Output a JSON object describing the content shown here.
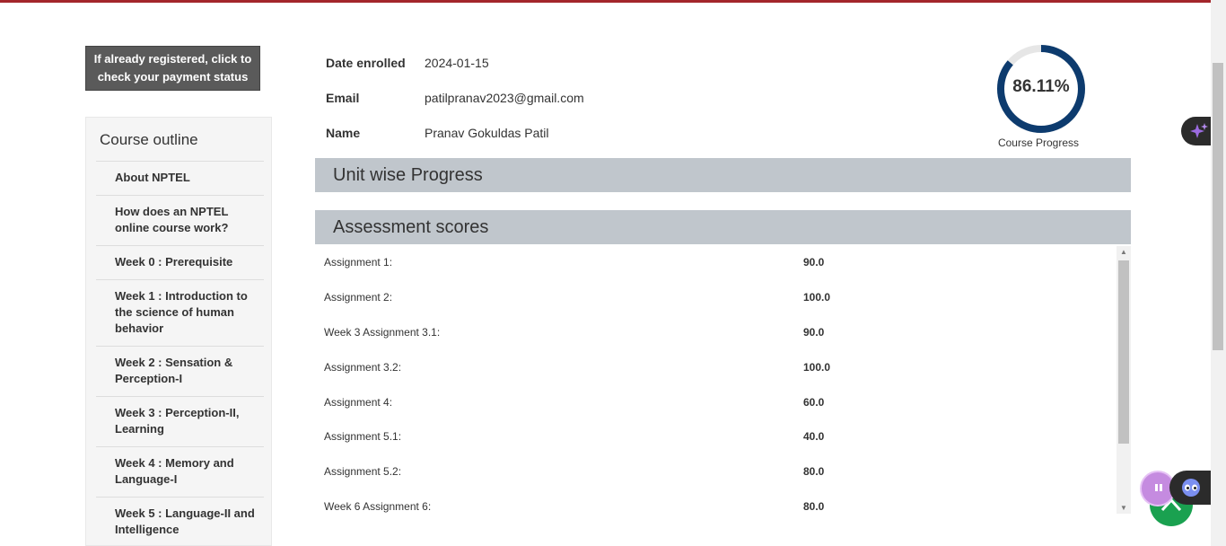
{
  "registration_button": "If already registered, click to check your payment status",
  "outline": {
    "title": "Course outline",
    "items": [
      "About NPTEL",
      "How does an NPTEL online course work?",
      "Week 0 : Prerequisite",
      "Week 1 : Introduction to the science of human behavior",
      "Week 2 : Sensation & Perception-I",
      "Week 3 : Perception-II, Learning",
      "Week 4 : Memory and Language-I",
      "Week 5 : Language-II and Intelligence"
    ]
  },
  "profile": {
    "date_label": "Date enrolled",
    "date_value": "2024-01-15",
    "email_label": "Email",
    "email_value": "patilpranav2023@gmail.com",
    "name_label": "Name",
    "name_value": "Pranav Gokuldas Patil"
  },
  "progress": {
    "percent_text": "86.11%",
    "fraction": 0.8611,
    "label": "Course Progress",
    "color": "#0d3b6e"
  },
  "sections": {
    "unit_progress": "Unit wise Progress",
    "assessment": "Assessment scores"
  },
  "scores": [
    {
      "name": "Assignment 1:",
      "value": "90.0"
    },
    {
      "name": "Assignment 2:",
      "value": "100.0"
    },
    {
      "name": "Week 3 Assignment 3.1:",
      "value": "90.0"
    },
    {
      "name": "Assignment 3.2:",
      "value": "100.0"
    },
    {
      "name": "Assignment 4:",
      "value": "60.0"
    },
    {
      "name": "Assignment 5.1:",
      "value": "40.0"
    },
    {
      "name": "Assignment 5.2:",
      "value": "80.0"
    },
    {
      "name": "Week 6 Assignment 6:",
      "value": "80.0"
    }
  ],
  "icons": {
    "ai": "sparkle-icon",
    "scroll_top": "chevron-up-icon",
    "assistant": "robot-face-icon",
    "bubble": "chat-bubble-icon"
  },
  "colors": {
    "top_bar": "#a3262b",
    "section_bar": "#c0c6cc",
    "up_button": "#1aa150"
  }
}
